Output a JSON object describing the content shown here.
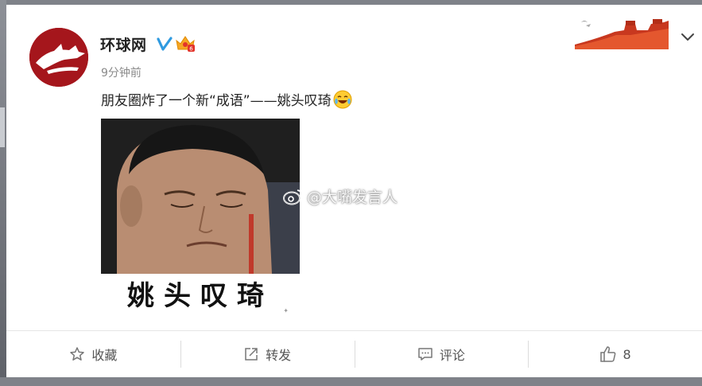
{
  "colors": {
    "brand_red": "#a5161c",
    "verified_blue": "#ff9800",
    "text_dark": "#222222",
    "text_muted": "#8a8a8a"
  },
  "post": {
    "author": "环球网",
    "time": "9分钟前",
    "text": "朋友圈炸了一个新“成语”——姚头叹琦",
    "emoji": "crying-laughing-emoji",
    "image_caption": "姚头叹琦",
    "watermark": "@大嘴发言人"
  },
  "icons": {
    "verified": "verified-v-icon",
    "vip": "vip-crown-icon",
    "menu": "chevron-down-icon"
  },
  "actions": [
    {
      "label": "收藏",
      "icon": "star-icon"
    },
    {
      "label": "转发",
      "icon": "share-icon"
    },
    {
      "label": "评论",
      "icon": "comment-icon"
    },
    {
      "label": "8",
      "icon": "thumbs-up-icon"
    }
  ]
}
